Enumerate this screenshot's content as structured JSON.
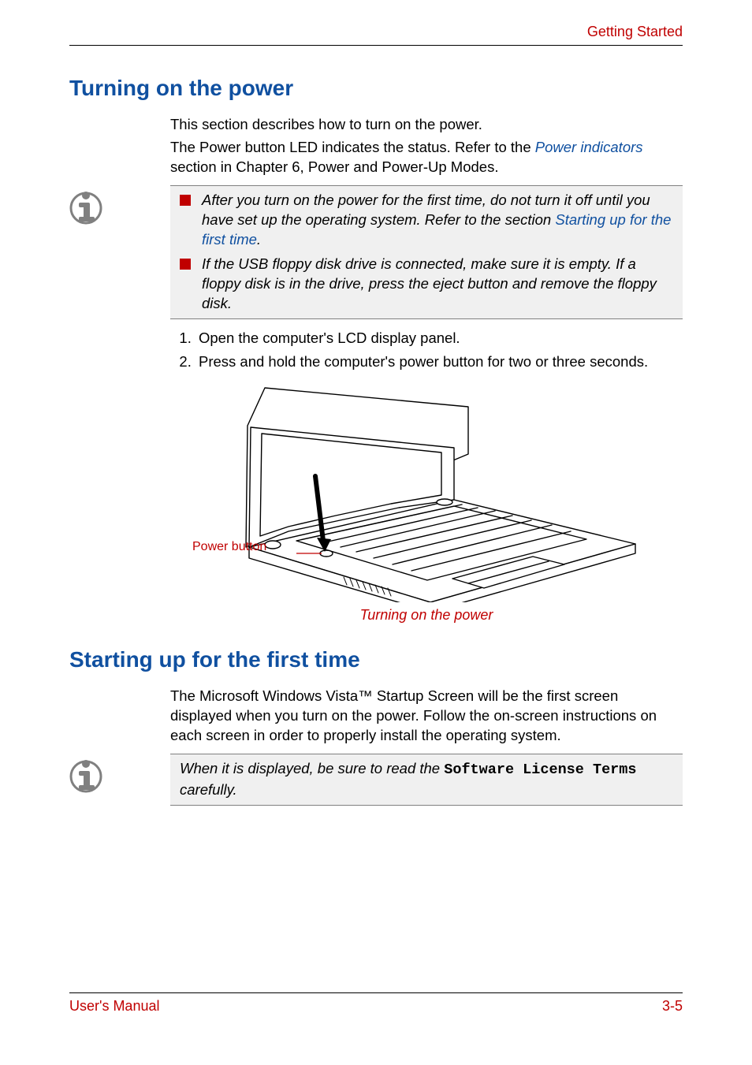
{
  "header": {
    "section": "Getting Started"
  },
  "sections": {
    "turning_on": {
      "title": "Turning on the power",
      "intro1": "This section describes how to turn on the power.",
      "intro2_pre": "The Power button LED indicates the status. Refer to the ",
      "intro2_link": "Power indicators",
      "intro2_post": " section in Chapter 6, Power and Power-Up Modes."
    },
    "info1": {
      "bullet1_pre": "After you turn on the power for the first time, do not turn it off until you have set up the operating system. Refer to the section ",
      "bullet1_link": "Starting up for the first time",
      "bullet1_post": ".",
      "bullet2": "If the USB floppy disk drive is connected, make sure it is empty. If a floppy disk is in the drive, press the eject button and remove the floppy disk."
    },
    "steps": {
      "s1": "Open the computer's LCD display panel.",
      "s2": "Press and hold the computer's power button for two or three seconds."
    },
    "figure": {
      "callout": "Power button",
      "caption": "Turning on the power"
    },
    "starting_up": {
      "title": "Starting up for the first time",
      "body": "The Microsoft Windows Vista™ Startup Screen will be the first screen displayed when you turn on the power. Follow the on-screen instructions on each screen in order to properly install the operating system."
    },
    "info2": {
      "pre": "When it is displayed, be sure to read the ",
      "mono": "Software License Terms",
      "post": " carefully."
    }
  },
  "footer": {
    "left": "User's Manual",
    "right": "3-5"
  }
}
